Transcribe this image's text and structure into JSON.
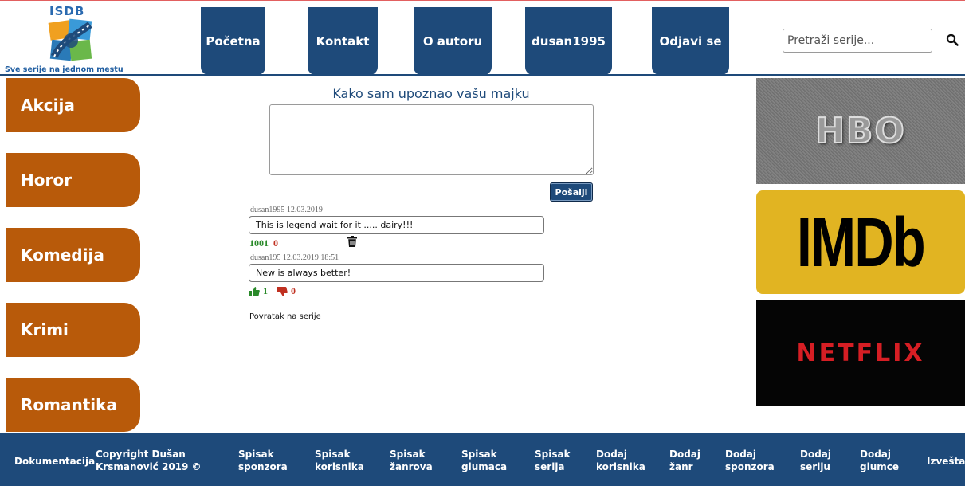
{
  "logo": {
    "title": "ISDB",
    "tagline": "Sve serije na jednom mestu"
  },
  "nav": [
    {
      "label": "Početna"
    },
    {
      "label": "Kontakt"
    },
    {
      "label": "O autoru"
    },
    {
      "label": "dusan1995"
    },
    {
      "label": "Odjavi se"
    }
  ],
  "search": {
    "placeholder": "Pretraži serije...",
    "icon": "search-icon"
  },
  "categories": [
    "Akcija",
    "Horor",
    "Komedija",
    "Krimi",
    "Romantika"
  ],
  "main": {
    "series_title": "Kako sam upoznao vašu majku",
    "send_label": "Pošalji",
    "comments": [
      {
        "meta": "dusan1995 12.03.2019",
        "text": "This is legend wait for it ..... dairy!!!",
        "likes": "1001",
        "dislikes": "0"
      },
      {
        "meta": "dusan195 12.03.2019 18:51",
        "text": "New is always better!",
        "likes": "1",
        "dislikes": "0"
      }
    ],
    "back_link": "Povratak na serije"
  },
  "sponsors": [
    {
      "name": "HBO"
    },
    {
      "name": "IMDb"
    },
    {
      "name": "NETFLIX"
    }
  ],
  "footer": {
    "items": [
      "Dokumentacija",
      "Copyright Dušan Krsmanović 2019 ©",
      "Spisak sponzora",
      "Spisak korisnika",
      "Spisak žanrova",
      "Spisak glumaca",
      "Spisak serija",
      "Dodaj korisnika",
      "Dodaj žanr",
      "Dodaj sponzora",
      "Dodaj seriju",
      "Dodaj glumce",
      "Izveštaj"
    ]
  },
  "colors": {
    "primary": "#1e4a7a",
    "category": "#b85a0a",
    "like": "#2a8a2a",
    "dislike": "#c03020"
  }
}
